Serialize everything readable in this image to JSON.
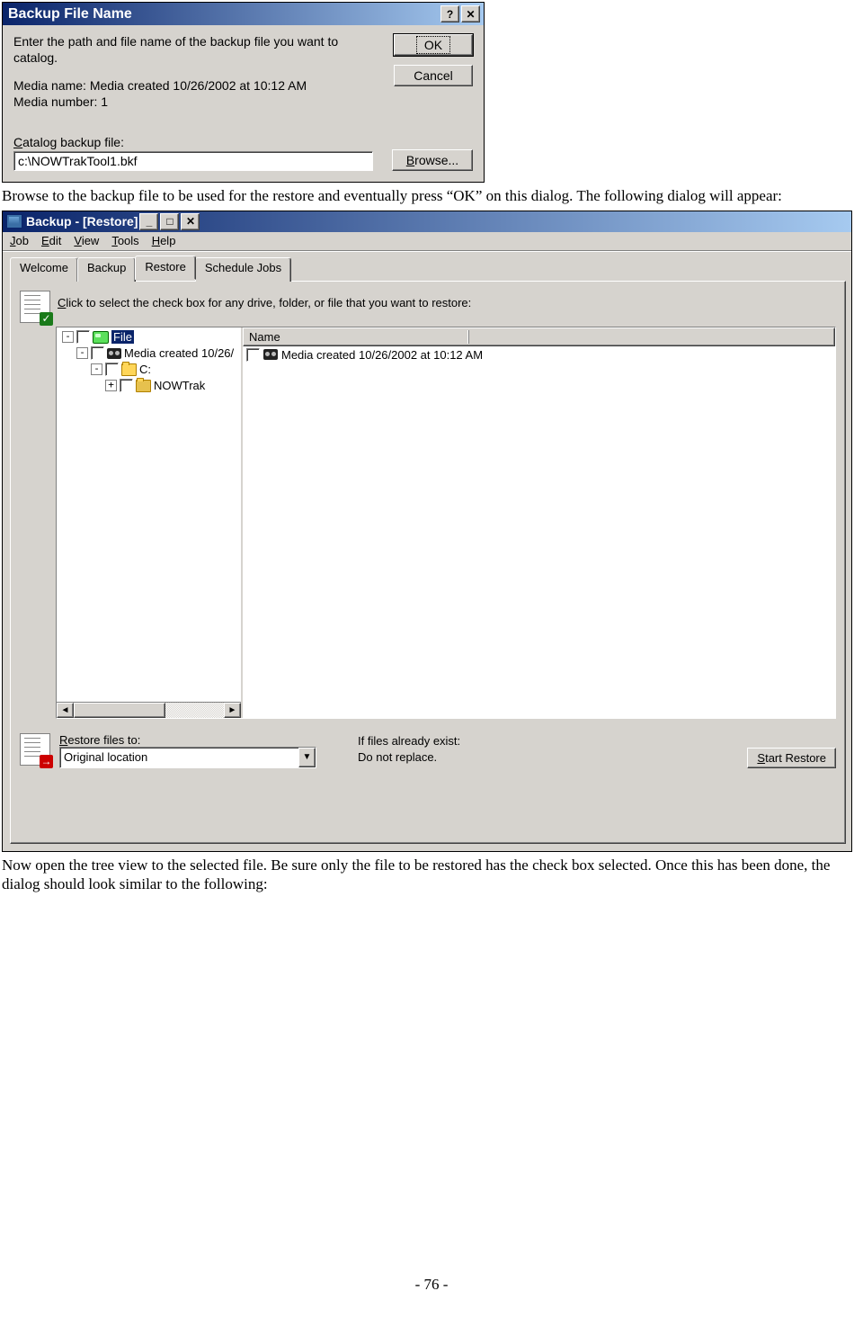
{
  "dialog1": {
    "title": "Backup File Name",
    "instruction": "Enter the path and file name of the backup file you want to catalog.",
    "media_line": "Media name: Media created 10/26/2002 at 10:12 AM",
    "media_number": "Media number: 1",
    "field_label": "Catalog backup file:",
    "field_value": "c:\\NOWTrakTool1.bkf",
    "ok": "OK",
    "cancel": "Cancel",
    "browse": "Browse..."
  },
  "doc": {
    "para1": "Browse to the backup file to be used for the restore and eventually press “OK” on this dialog. The following dialog will appear:",
    "para2": "Now open the tree view to the selected file. Be sure only the file to be restored has the check box selected.  Once this has been done, the dialog should look similar to the following:",
    "page_num": "- 76 -"
  },
  "dialog2": {
    "title": "Backup - [Restore]",
    "menu": {
      "job": "Job",
      "edit": "Edit",
      "view": "View",
      "tools": "Tools",
      "help": "Help"
    },
    "tabs": {
      "welcome": "Welcome",
      "backup": "Backup",
      "restore": "Restore",
      "schedule": "Schedule Jobs"
    },
    "instr": "Click to select the check box for any drive, folder, or file that you want to restore:",
    "tree": {
      "root": "File",
      "media": "Media created 10/26/",
      "drive": "C:",
      "folder": "NOWTrak"
    },
    "list": {
      "name_col": "Name",
      "item": "Media created 10/26/2002 at 10:12 AM"
    },
    "restore_label": "Restore files to:",
    "restore_value": "Original location",
    "exist_label": "If files already exist:",
    "exist_value": "Do not replace.",
    "start": "Start Restore"
  }
}
